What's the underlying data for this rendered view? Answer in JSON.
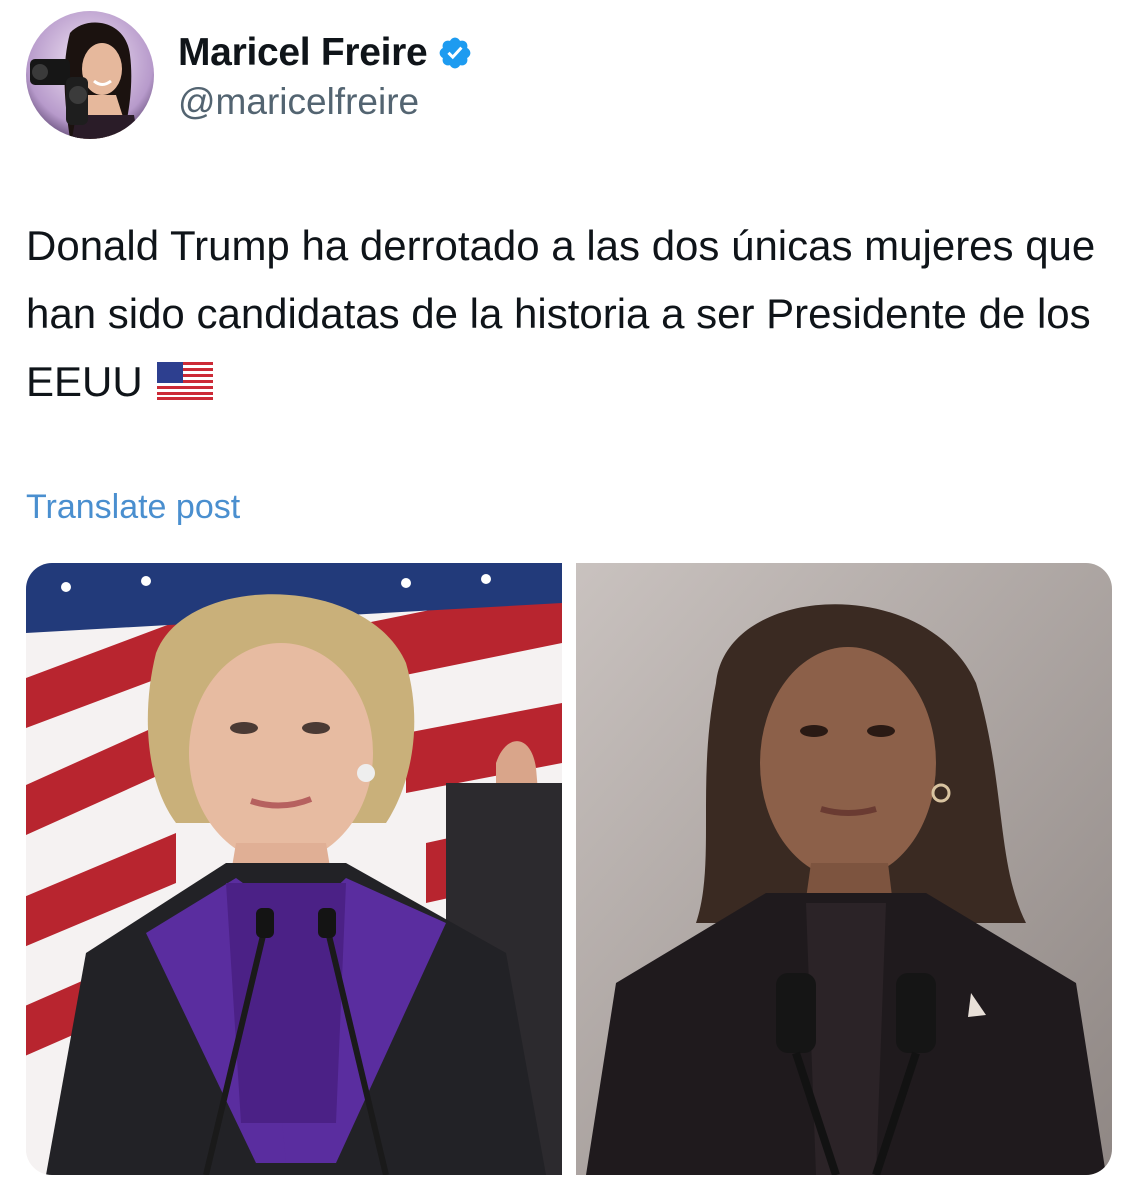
{
  "author": {
    "display_name": "Maricel Freire",
    "handle": "@maricelfreire",
    "verified": true
  },
  "post": {
    "text": "Donald Trump  ha derrotado a las dos únicas mujeres que han sido candidatas de la historia a ser Presidente de los EEUU",
    "flag": "🇺🇸",
    "translate_label": "Translate post"
  },
  "media": [
    {
      "icon": "photo",
      "subject": "woman-speaking-at-podium-with-flag"
    },
    {
      "icon": "photo",
      "subject": "woman-speaking-at-podium"
    }
  ],
  "colors": {
    "text": "#0f1419",
    "secondary_text": "#536471",
    "link": "#4a8fcf",
    "verified_badge": "#1d9bf0"
  }
}
